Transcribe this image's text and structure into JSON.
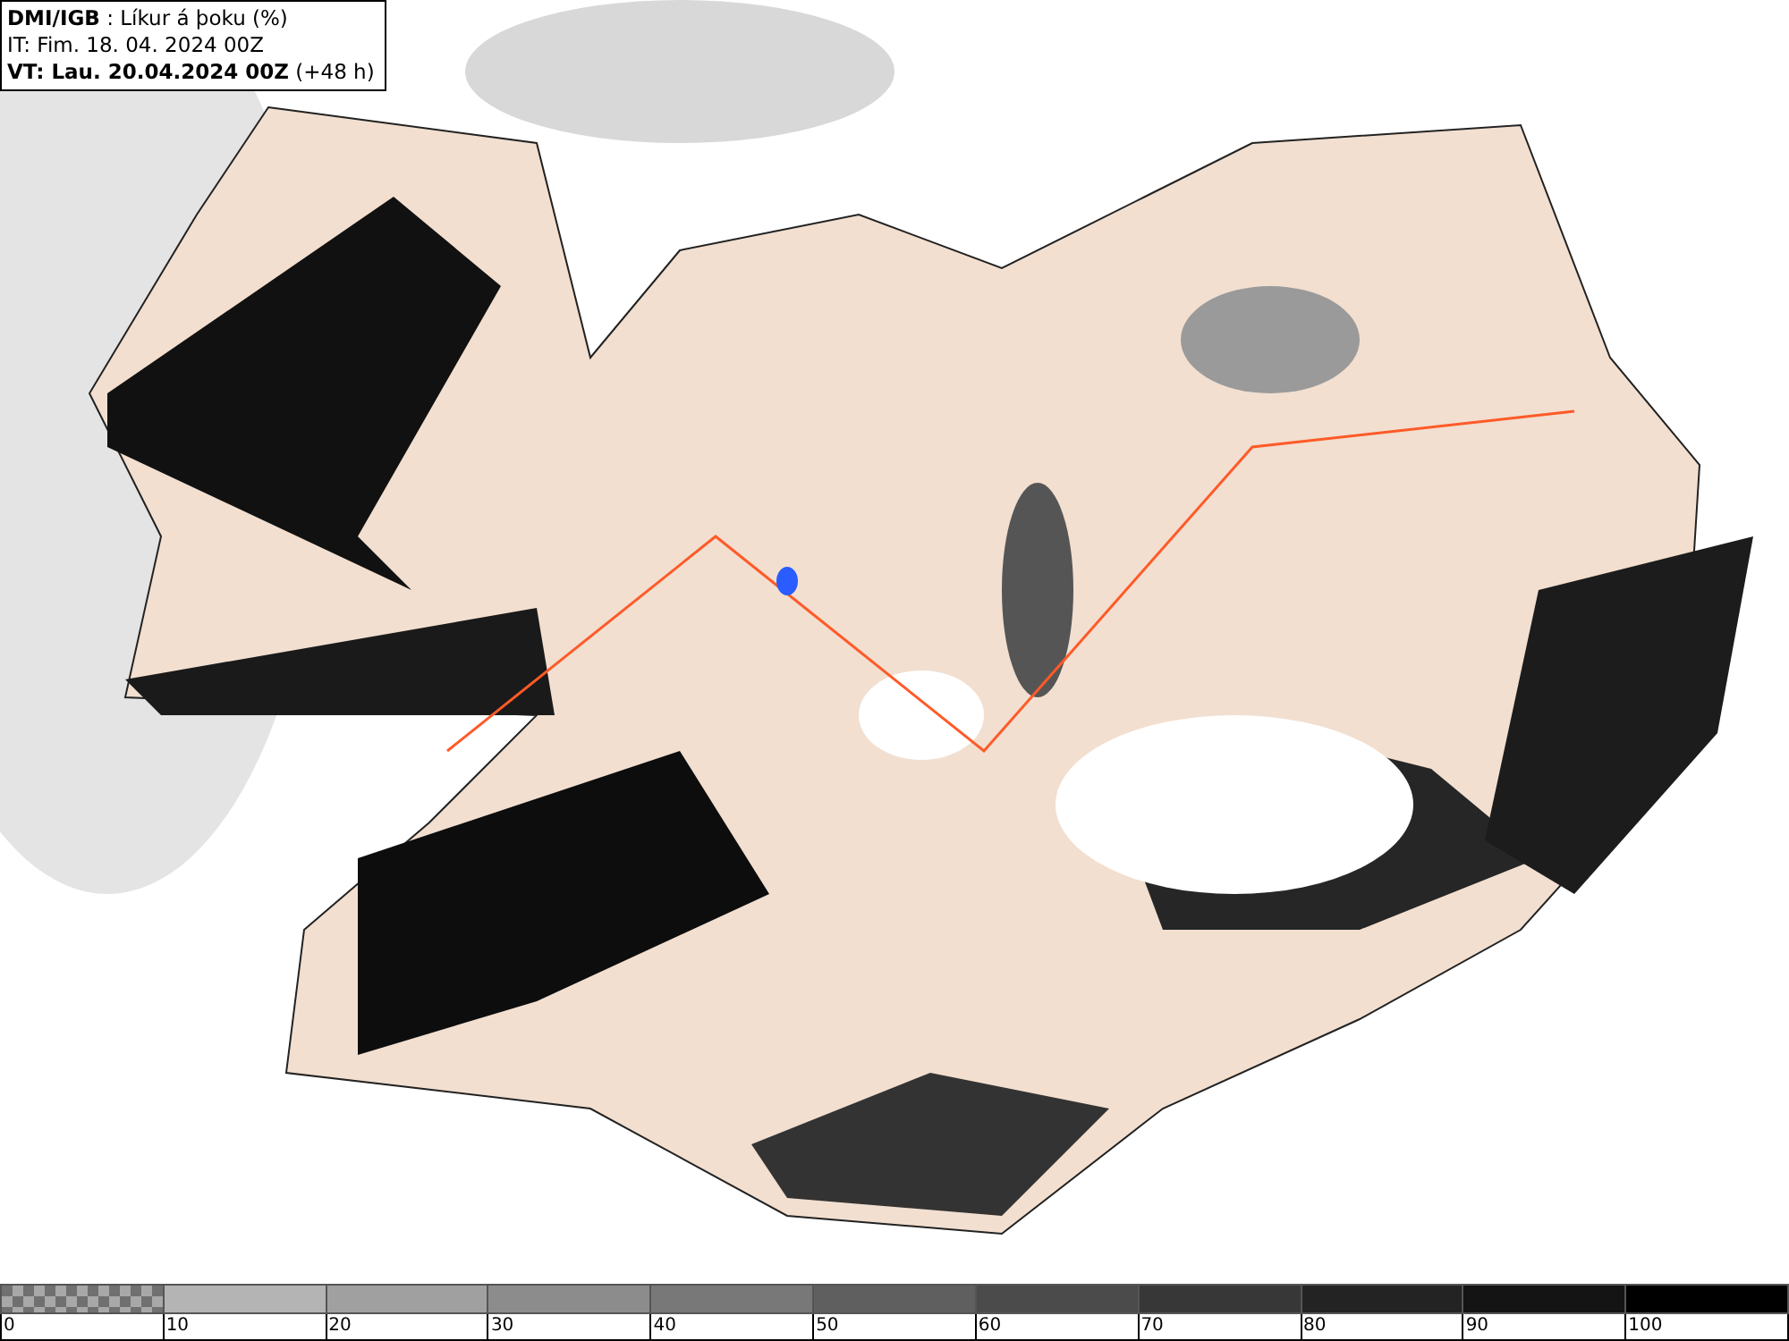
{
  "legend": {
    "lines": [
      "**DMI/IGB** : Líkur á þoku (%)",
      "IT: Fim. 18. 04. 2024 00Z",
      "**VT: Lau. 20.04.2024 00Z** (+48 h)"
    ]
  },
  "colorbar": {
    "segments": [
      {
        "kind": "checker",
        "color": "#707070"
      },
      {
        "kind": "solid",
        "color": "#b4b4b4"
      },
      {
        "kind": "solid",
        "color": "#a0a0a0"
      },
      {
        "kind": "solid",
        "color": "#8c8c8c"
      },
      {
        "kind": "solid",
        "color": "#787878"
      },
      {
        "kind": "solid",
        "color": "#5f5f5f"
      },
      {
        "kind": "solid",
        "color": "#4b4b4b"
      },
      {
        "kind": "solid",
        "color": "#373737"
      },
      {
        "kind": "solid",
        "color": "#232323"
      },
      {
        "kind": "solid",
        "color": "#141414"
      },
      {
        "kind": "solid",
        "color": "#000000"
      }
    ],
    "labels": [
      "0",
      "10",
      "20",
      "30",
      "40",
      "50",
      "60",
      "70",
      "80",
      "90",
      "100"
    ]
  }
}
